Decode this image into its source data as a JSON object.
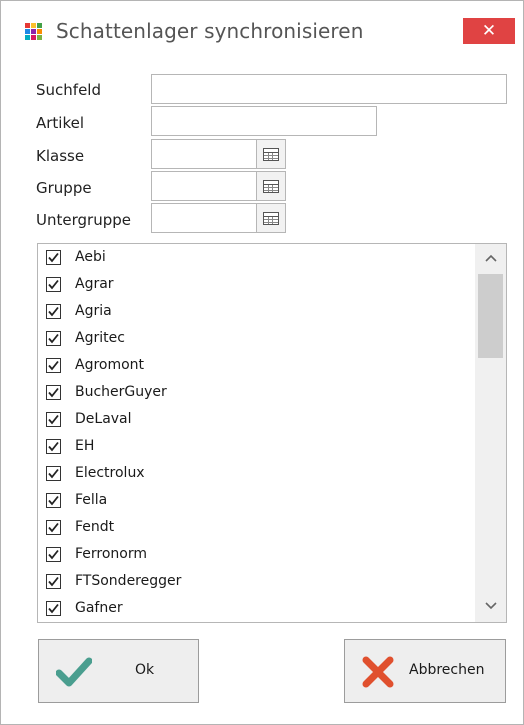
{
  "window": {
    "title": "Schattenlager synchronisieren",
    "close_label": "✕",
    "icon_colors": [
      "#e53935",
      "#fbc02d",
      "#43a047",
      "#1e88e5",
      "#8e24aa",
      "#fb8c00",
      "#00acc1",
      "#d81b60",
      "#7cb342"
    ]
  },
  "form": {
    "suchfeld": {
      "label": "Suchfeld",
      "value": ""
    },
    "artikel": {
      "label": "Artikel",
      "value": ""
    },
    "klasse": {
      "label": "Klasse",
      "value": ""
    },
    "gruppe": {
      "label": "Gruppe",
      "value": ""
    },
    "untergruppe": {
      "label": "Untergruppe",
      "value": ""
    }
  },
  "list": {
    "items": [
      {
        "label": "Aebi",
        "checked": true
      },
      {
        "label": "Agrar",
        "checked": true
      },
      {
        "label": "Agria",
        "checked": true
      },
      {
        "label": "Agritec",
        "checked": true
      },
      {
        "label": "Agromont",
        "checked": true
      },
      {
        "label": "BucherGuyer",
        "checked": true
      },
      {
        "label": "DeLaval",
        "checked": true
      },
      {
        "label": "EH",
        "checked": true
      },
      {
        "label": "Electrolux",
        "checked": true
      },
      {
        "label": "Fella",
        "checked": true
      },
      {
        "label": "Fendt",
        "checked": true
      },
      {
        "label": "Ferronorm",
        "checked": true
      },
      {
        "label": "FTSonderegger",
        "checked": true
      },
      {
        "label": "Gafner",
        "checked": true
      }
    ],
    "scroll_up_icon": "chevron-up-icon",
    "scroll_down_icon": "chevron-down-icon"
  },
  "buttons": {
    "ok": {
      "label": "Ok",
      "icon": "checkmark-icon",
      "icon_color": "#4a9e8f"
    },
    "cancel": {
      "label": "Abbrechen",
      "icon": "x-cross-icon",
      "icon_color": "#e0502e"
    }
  }
}
